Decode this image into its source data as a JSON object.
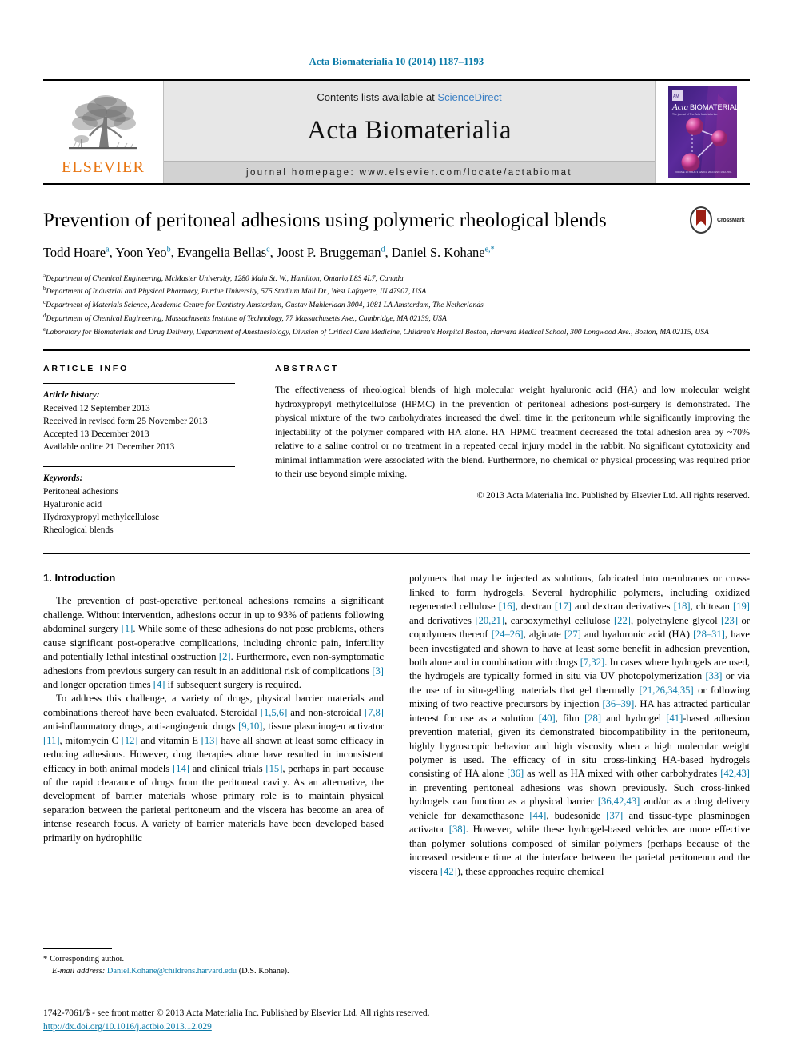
{
  "running_head": "Acta Biomaterialia 10 (2014) 1187–1193",
  "masthead": {
    "publisher_name": "ELSEVIER",
    "contents_prefix": "Contents lists available at ",
    "contents_link": "ScienceDirect",
    "journal_title": "Acta Biomaterialia",
    "homepage": "journal homepage: www.elsevier.com/locate/actabiomat",
    "cover_title_top": "Acta",
    "cover_title_main": "BIOMATERIALIA",
    "cover_subtitle": "The journal of The Acta Materialia Inc."
  },
  "article": {
    "title": "Prevention of peritoneal adhesions using polymeric rheological blends",
    "crossmark_label": "CrossMark",
    "authors": [
      {
        "name": "Todd Hoare",
        "sup": "a",
        "sep": ", "
      },
      {
        "name": "Yoon Yeo",
        "sup": "b",
        "sep": ", "
      },
      {
        "name": "Evangelia Bellas",
        "sup": "c",
        "sep": ", "
      },
      {
        "name": "Joost P. Bruggeman",
        "sup": "d",
        "sep": ", "
      },
      {
        "name": "Daniel S. Kohane",
        "sup": "e,*",
        "sep": ""
      }
    ],
    "affiliations": [
      {
        "marker": "a",
        "text": "Department of Chemical Engineering, McMaster University, 1280 Main St. W., Hamilton, Ontario L8S 4L7, Canada"
      },
      {
        "marker": "b",
        "text": "Department of Industrial and Physical Pharmacy, Purdue University, 575 Stadium Mall Dr., West Lafayette, IN 47907, USA"
      },
      {
        "marker": "c",
        "text": "Department of Materials Science, Academic Centre for Dentistry Amsterdam, Gustav Mahlerlaan 3004, 1081 LA Amsterdam, The Netherlands"
      },
      {
        "marker": "d",
        "text": "Department of Chemical Engineering, Massachusetts Institute of Technology, 77 Massachusetts Ave., Cambridge, MA 02139, USA"
      },
      {
        "marker": "e",
        "text": "Laboratory for Biomaterials and Drug Delivery, Department of Anesthesiology, Division of Critical Care Medicine, Children's Hospital Boston, Harvard Medical School, 300 Longwood Ave., Boston, MA 02115, USA"
      }
    ]
  },
  "article_info": {
    "heading": "ARTICLE INFO",
    "history_title": "Article history:",
    "history": [
      "Received 12 September 2013",
      "Received in revised form 25 November 2013",
      "Accepted 13 December 2013",
      "Available online 21 December 2013"
    ],
    "keywords_title": "Keywords:",
    "keywords": [
      "Peritoneal adhesions",
      "Hyaluronic acid",
      "Hydroxypropyl methylcellulose",
      "Rheological blends"
    ]
  },
  "abstract": {
    "heading": "ABSTRACT",
    "text": "The effectiveness of rheological blends of high molecular weight hyaluronic acid (HA) and low molecular weight hydroxypropyl methylcellulose (HPMC) in the prevention of peritoneal adhesions post-surgery is demonstrated. The physical mixture of the two carbohydrates increased the dwell time in the peritoneum while significantly improving the injectability of the polymer compared with HA alone. HA–HPMC treatment decreased the total adhesion area by ~70% relative to a saline control or no treatment in a repeated cecal injury model in the rabbit. No significant cytotoxicity and minimal inflammation were associated with the blend. Furthermore, no chemical or physical processing was required prior to their use beyond simple mixing.",
    "copyright": "© 2013 Acta Materialia Inc. Published by Elsevier Ltd. All rights reserved."
  },
  "introduction": {
    "section_title": "1. Introduction",
    "left_paragraphs": [
      "The prevention of post-operative peritoneal adhesions remains a significant challenge. Without intervention, adhesions occur in up to 93% of patients following abdominal surgery [1]. While some of these adhesions do not pose problems, others cause significant post-operative complications, including chronic pain, infertility and potentially lethal intestinal obstruction [2]. Furthermore, even non-symptomatic adhesions from previous surgery can result in an additional risk of complications [3] and longer operation times [4] if subsequent surgery is required.",
      "To address this challenge, a variety of drugs, physical barrier materials and combinations thereof have been evaluated. Steroidal [1,5,6] and non-steroidal [7,8] anti-inflammatory drugs, anti-angiogenic drugs [9,10], tissue plasminogen activator [11], mitomycin C [12] and vitamin E [13] have all shown at least some efficacy in reducing adhesions. However, drug therapies alone have resulted in inconsistent efficacy in both animal models [14] and clinical trials [15], perhaps in part because of the rapid clearance of drugs from the peritoneal cavity. As an alternative, the development of barrier materials whose primary role is to maintain physical separation between the parietal peritoneum and the viscera has become an area of intense research focus. A variety of barrier materials have been developed based primarily on hydrophilic"
    ],
    "right_paragraphs": [
      "polymers that may be injected as solutions, fabricated into membranes or cross-linked to form hydrogels. Several hydrophilic polymers, including oxidized regenerated cellulose [16], dextran [17] and dextran derivatives [18], chitosan [19] and derivatives [20,21], carboxymethyl cellulose [22], polyethylene glycol [23] or copolymers thereof [24–26], alginate [27] and hyaluronic acid (HA) [28–31], have been investigated and shown to have at least some benefit in adhesion prevention, both alone and in combination with drugs [7,32]. In cases where hydrogels are used, the hydrogels are typically formed in situ via UV photopolymerization [33] or via the use of in situ-gelling materials that gel thermally [21,26,34,35] or following mixing of two reactive precursors by injection [36–39]. HA has attracted particular interest for use as a solution [40], film [28] and hydrogel [41]-based adhesion prevention material, given its demonstrated biocompatibility in the peritoneum, highly hygroscopic behavior and high viscosity when a high molecular weight polymer is used. The efficacy of in situ cross-linking HA-based hydrogels consisting of HA alone [36] as well as HA mixed with other carbohydrates [42,43] in preventing peritoneal adhesions was shown previously. Such cross-linked hydrogels can function as a physical barrier [36,42,43] and/or as a drug delivery vehicle for dexamethasone [44], budesonide [37] and tissue-type plasminogen activator [38]. However, while these hydrogel-based vehicles are more effective than polymer solutions composed of similar polymers (perhaps because of the increased residence time at the interface between the parietal peritoneum and the viscera [42]), these approaches require chemical"
    ]
  },
  "footnote": {
    "corresponding_marker": "*",
    "corresponding_text": "Corresponding author.",
    "email_label": "E-mail address:",
    "email": "Daniel.Kohane@childrens.harvard.edu",
    "email_owner": "(D.S. Kohane)."
  },
  "footer": {
    "issn_line": "1742-7061/$ - see front matter © 2013 Acta Materialia Inc. Published by Elsevier Ltd. All rights reserved.",
    "doi": "http://dx.doi.org/10.1016/j.actbio.2013.12.029"
  },
  "colors": {
    "link_teal": "#0a7aa8",
    "science_direct_blue": "#3a7fc4",
    "elsevier_orange": "#e87511",
    "masthead_gray": "#e7e7e7"
  }
}
